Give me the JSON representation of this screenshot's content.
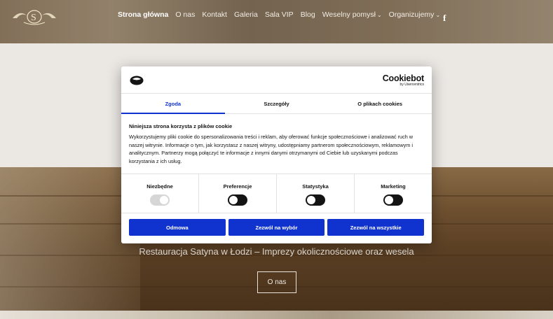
{
  "nav": {
    "items": [
      {
        "label": "Strona główna",
        "active": true,
        "dropdown": false
      },
      {
        "label": "O nas",
        "active": false,
        "dropdown": false
      },
      {
        "label": "Kontakt",
        "active": false,
        "dropdown": false
      },
      {
        "label": "Galeria",
        "active": false,
        "dropdown": false
      },
      {
        "label": "Sala VIP",
        "active": false,
        "dropdown": false
      },
      {
        "label": "Blog",
        "active": false,
        "dropdown": false
      },
      {
        "label": "Weselny pomysł",
        "active": false,
        "dropdown": true
      },
      {
        "label": "Organizujemy",
        "active": false,
        "dropdown": true
      }
    ],
    "social_icon": "facebook-icon",
    "social_glyph": "f"
  },
  "hero": {
    "subtitle": "Restauracja Satyna w Łodzi – Imprezy okolicznościowe oraz wesela",
    "button_label": "O nas"
  },
  "cookie_dialog": {
    "brand_name": "Cookiebot",
    "brand_sub": "by Usercentrics",
    "tabs": [
      "Zgoda",
      "Szczegóły",
      "O plikach cookies"
    ],
    "active_tab": "Zgoda",
    "title": "Niniejsza strona korzysta z plików cookie",
    "text": "Wykorzystujemy pliki cookie do spersonalizowania treści i reklam, aby oferować funkcje społecznościowe i analizować ruch w naszej witrynie. Informacje o tym, jak korzystasz z naszej witryny, udostępniamy partnerom społecznościowym, reklamowym i analitycznym. Partnerzy mogą połączyć te informacje z innymi danymi otrzymanymi od Ciebie lub uzyskanymi podczas korzystania z ich usług.",
    "toggles": [
      {
        "label": "Niezbędne",
        "on": true,
        "disabled": true
      },
      {
        "label": "Preferencje",
        "on": false,
        "disabled": false
      },
      {
        "label": "Statystyka",
        "on": false,
        "disabled": false
      },
      {
        "label": "Marketing",
        "on": false,
        "disabled": false
      }
    ],
    "buttons": {
      "deny": "Odmowa",
      "allow_selection": "Zezwól na wybór",
      "allow_all": "Zezwól na wszystkie"
    },
    "accent_color": "#1032cf"
  }
}
